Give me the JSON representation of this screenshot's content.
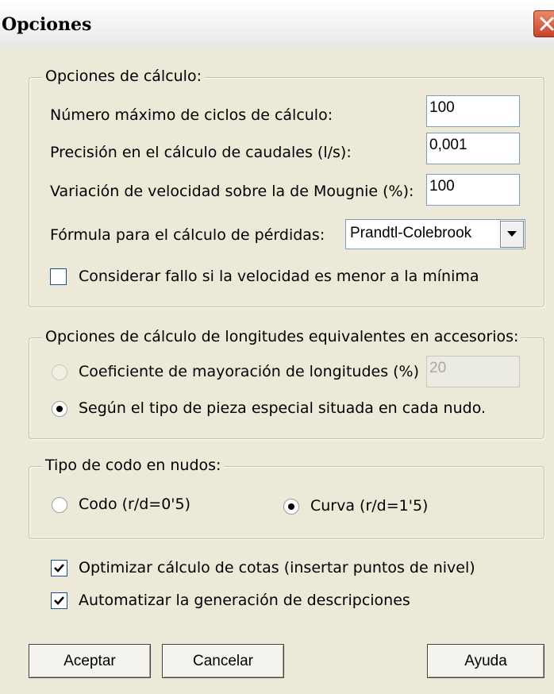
{
  "window": {
    "title": "Opciones"
  },
  "calc": {
    "legend": "Opciones de cálculo:",
    "max_cycles_label": "Número máximo de ciclos de cálculo:",
    "max_cycles_value": "100",
    "precision_label": "Precisión en el cálculo de caudales (l/s):",
    "precision_value": "0,001",
    "velocity_label": "Variación de velocidad sobre la de Mougnie (%):",
    "velocity_value": "100",
    "formula_label": "Fórmula para el cálculo de pérdidas:",
    "formula_selected": "Prandtl-Colebrook",
    "failure_label": "Considerar fallo si  la velocidad es menor a la mínima",
    "failure_checked": false
  },
  "equiv": {
    "legend": "Opciones de cálculo de longitudes equivalentes en accesorios:",
    "coef_label": "Coeficiente de mayoración de longitudes (%)",
    "coef_value": "20",
    "piece_label": "Según el tipo de pieza especial situada en cada nudo.",
    "selected": "piece"
  },
  "elbow": {
    "legend": "Tipo de codo en nudos:",
    "codo_label": "Codo (r/d=0'5)",
    "curva_label": "Curva (r/d=1'5)",
    "selected": "curva"
  },
  "options": {
    "optimize_label": "Optimizar cálculo de cotas (insertar puntos de nivel)",
    "optimize_checked": true,
    "auto_label": "Automatizar la generación de descripciones",
    "auto_checked": true
  },
  "buttons": {
    "accept": "Aceptar",
    "cancel": "Cancelar",
    "help": "Ayuda"
  },
  "colors": {
    "close_button": "#c9432a",
    "dialog_bg": "#ece9d8",
    "input_border": "#7f9db9"
  },
  "icons": {
    "close": "close-icon",
    "dropdown": "chevron-down-icon",
    "check": "check-icon"
  }
}
